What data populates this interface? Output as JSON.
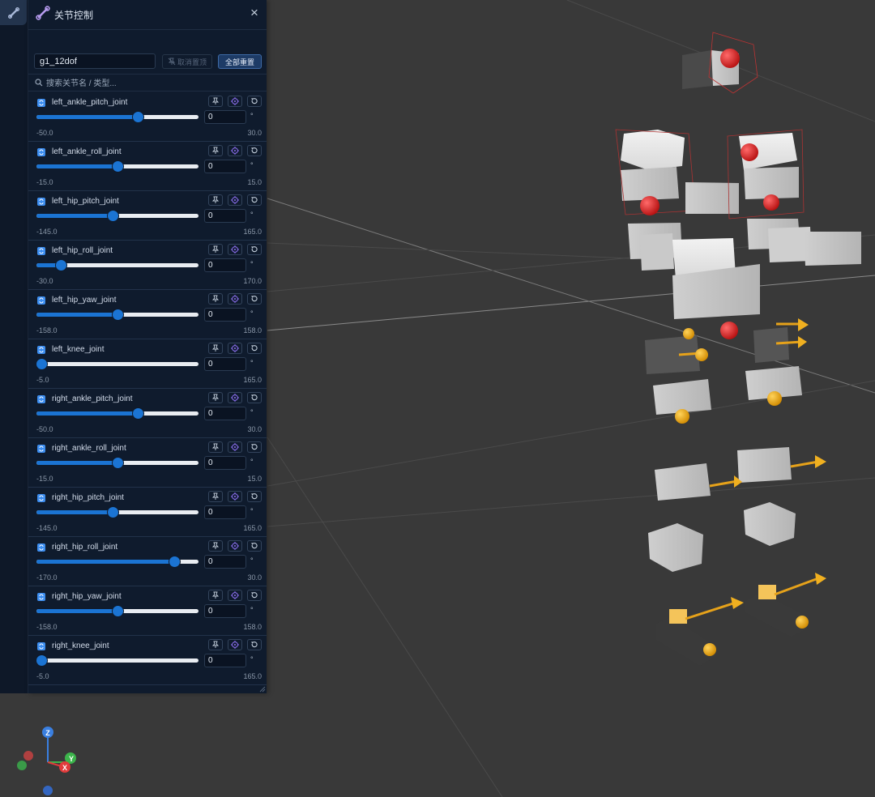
{
  "panel": {
    "title": "关节控制",
    "close_glyph": "×",
    "robot_name": "g1_12dof",
    "cancel_pin_label": "取消置顶",
    "reset_all_label": "全部重置",
    "search_placeholder": "搜索关节名 / 类型..."
  },
  "icons": {
    "rail": "bone-icon",
    "title": "bone-icon",
    "close": "close-icon",
    "pin": "pin-icon",
    "target": "target-icon",
    "reset": "reset-icon",
    "search": "search-icon",
    "joint_type": "revolute-joint-icon"
  },
  "colors": {
    "accent": "#1b74d3",
    "panel_bg": "#0f1b2d",
    "viewport_bg": "#393939",
    "axis_x": "#e03b3b",
    "axis_y": "#3cb44b",
    "axis_z": "#3a7fe0"
  },
  "joints": [
    {
      "name": "left_ankle_pitch_joint",
      "value": "0",
      "unit": "°",
      "min": "-50.0",
      "max": "30.0",
      "level": 0.625
    },
    {
      "name": "left_ankle_roll_joint",
      "value": "0",
      "unit": "°",
      "min": "-15.0",
      "max": "15.0",
      "level": 0.5
    },
    {
      "name": "left_hip_pitch_joint",
      "value": "0",
      "unit": "°",
      "min": "-145.0",
      "max": "165.0",
      "level": 0.468
    },
    {
      "name": "left_hip_roll_joint",
      "value": "0",
      "unit": "°",
      "min": "-30.0",
      "max": "170.0",
      "level": 0.15
    },
    {
      "name": "left_hip_yaw_joint",
      "value": "0",
      "unit": "°",
      "min": "-158.0",
      "max": "158.0",
      "level": 0.5
    },
    {
      "name": "left_knee_joint",
      "value": "0",
      "unit": "°",
      "min": "-5.0",
      "max": "165.0",
      "level": 0.029
    },
    {
      "name": "right_ankle_pitch_joint",
      "value": "0",
      "unit": "°",
      "min": "-50.0",
      "max": "30.0",
      "level": 0.625
    },
    {
      "name": "right_ankle_roll_joint",
      "value": "0",
      "unit": "°",
      "min": "-15.0",
      "max": "15.0",
      "level": 0.5
    },
    {
      "name": "right_hip_pitch_joint",
      "value": "0",
      "unit": "°",
      "min": "-145.0",
      "max": "165.0",
      "level": 0.468
    },
    {
      "name": "right_hip_roll_joint",
      "value": "0",
      "unit": "°",
      "min": "-170.0",
      "max": "30.0",
      "level": 0.85
    },
    {
      "name": "right_hip_yaw_joint",
      "value": "0",
      "unit": "°",
      "min": "-158.0",
      "max": "158.0",
      "level": 0.5
    },
    {
      "name": "right_knee_joint",
      "value": "0",
      "unit": "°",
      "min": "-5.0",
      "max": "165.0",
      "level": 0.029
    }
  ],
  "gizmo": {
    "z_label": "Z",
    "y_label": "Y",
    "x_label": "X"
  }
}
